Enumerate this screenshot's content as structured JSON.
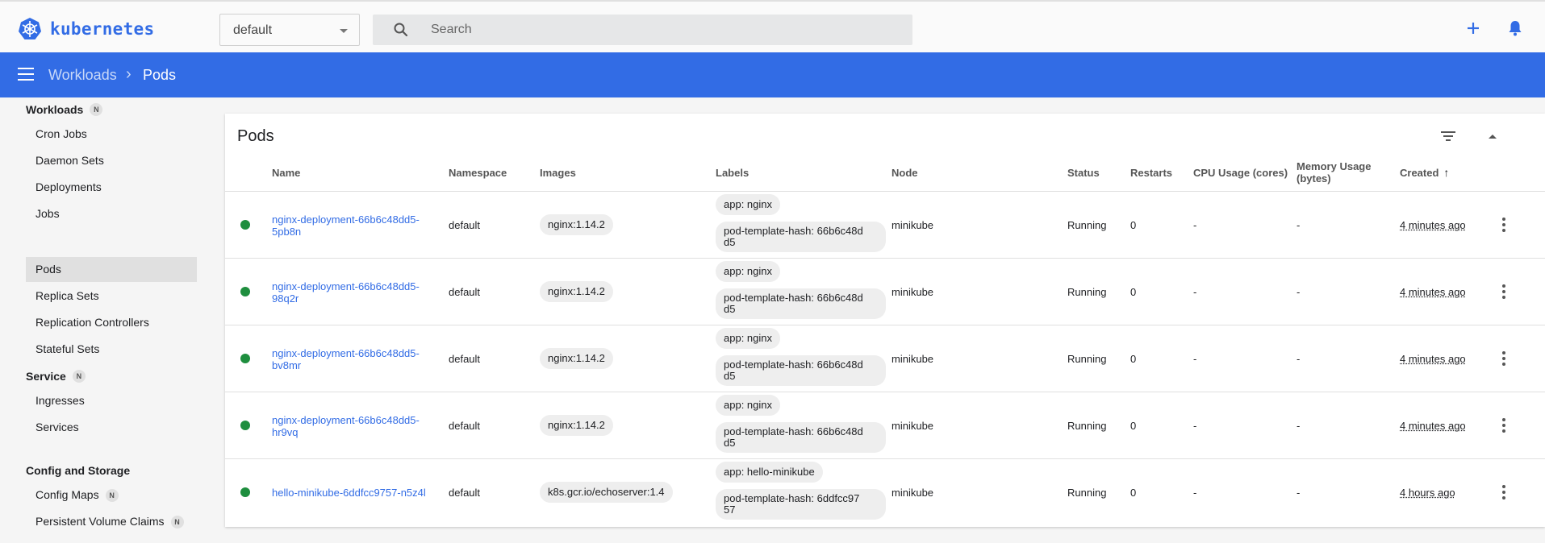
{
  "brand": {
    "name": "kubernetes",
    "color": "#326ce5"
  },
  "namespace": {
    "value": "default"
  },
  "search": {
    "placeholder": "Search"
  },
  "breadcrumb": {
    "parent": "Workloads",
    "separator": "›",
    "current": "Pods"
  },
  "sidebar": {
    "sections": [
      {
        "title": "Workloads",
        "badge": "N"
      },
      {
        "title": "Service",
        "badge": "N"
      },
      {
        "title": "Config and Storage",
        "badge": ""
      }
    ],
    "items": [
      {
        "label": "Cron Jobs",
        "badge": ""
      },
      {
        "label": "Daemon Sets",
        "badge": ""
      },
      {
        "label": "Deployments",
        "badge": ""
      },
      {
        "label": "Jobs",
        "badge": ""
      },
      {
        "label": "Pods",
        "badge": "",
        "active": true
      },
      {
        "label": "Replica Sets",
        "badge": ""
      },
      {
        "label": "Replication Controllers",
        "badge": ""
      },
      {
        "label": "Stateful Sets",
        "badge": ""
      },
      {
        "label": "Ingresses",
        "badge": ""
      },
      {
        "label": "Services",
        "badge": ""
      },
      {
        "label": "Config Maps",
        "badge": "N"
      },
      {
        "label": "Persistent Volume Claims",
        "badge": "N"
      }
    ]
  },
  "card": {
    "title": "Pods"
  },
  "columns": {
    "name": "Name",
    "namespace": "Namespace",
    "images": "Images",
    "labels": "Labels",
    "node": "Node",
    "status": "Status",
    "restarts": "Restarts",
    "cpu": "CPU Usage (cores)",
    "memory_l1": "Memory Usage",
    "memory_l2": "(bytes)",
    "created": "Created",
    "sort_indicator": "↑"
  },
  "rows": [
    {
      "name_l1": "nginx-deployment-66b6c48dd5-",
      "name_l2": "5pb8n",
      "namespace": "default",
      "image": "nginx:1.14.2",
      "label1": "app: nginx",
      "label2_l1": "pod-template-hash: 66b6c48d",
      "label2_l2": "d5",
      "node": "minikube",
      "status": "Running",
      "restarts": "0",
      "cpu": "-",
      "memory": "-",
      "created": "4 minutes ago"
    },
    {
      "name_l1": "nginx-deployment-66b6c48dd5-",
      "name_l2": "98q2r",
      "namespace": "default",
      "image": "nginx:1.14.2",
      "label1": "app: nginx",
      "label2_l1": "pod-template-hash: 66b6c48d",
      "label2_l2": "d5",
      "node": "minikube",
      "status": "Running",
      "restarts": "0",
      "cpu": "-",
      "memory": "-",
      "created": "4 minutes ago"
    },
    {
      "name_l1": "nginx-deployment-66b6c48dd5-",
      "name_l2": "bv8mr",
      "namespace": "default",
      "image": "nginx:1.14.2",
      "label1": "app: nginx",
      "label2_l1": "pod-template-hash: 66b6c48d",
      "label2_l2": "d5",
      "node": "minikube",
      "status": "Running",
      "restarts": "0",
      "cpu": "-",
      "memory": "-",
      "created": "4 minutes ago"
    },
    {
      "name_l1": "nginx-deployment-66b6c48dd5-",
      "name_l2": "hr9vq",
      "namespace": "default",
      "image": "nginx:1.14.2",
      "label1": "app: nginx",
      "label2_l1": "pod-template-hash: 66b6c48d",
      "label2_l2": "d5",
      "node": "minikube",
      "status": "Running",
      "restarts": "0",
      "cpu": "-",
      "memory": "-",
      "created": "4 minutes ago"
    },
    {
      "name_l1": "hello-minikube-6ddfcc9757-n5z4l",
      "name_l2": "",
      "namespace": "default",
      "image": "k8s.gcr.io/echoserver:1.4",
      "label1": "app: hello-minikube",
      "label2_l1": "pod-template-hash: 6ddfcc97",
      "label2_l2": "57",
      "node": "minikube",
      "status": "Running",
      "restarts": "0",
      "cpu": "-",
      "memory": "-",
      "created": "4 hours ago"
    }
  ],
  "colors": {
    "accent": "#326ce5",
    "status_running": "#1e8e3e"
  }
}
